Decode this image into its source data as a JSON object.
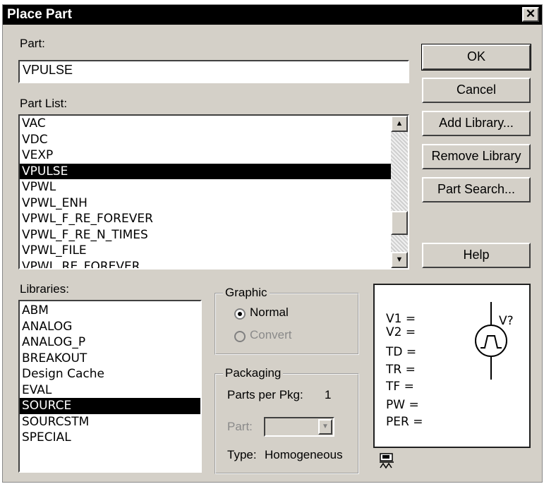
{
  "window": {
    "title": "Place Part",
    "close_glyph": "✕"
  },
  "part": {
    "label": "Part:",
    "value": "VPULSE"
  },
  "part_list": {
    "label": "Part List:",
    "items": [
      "VAC",
      "VDC",
      "VEXP",
      "VPULSE",
      "VPWL",
      "VPWL_ENH",
      "VPWL_F_RE_FOREVER",
      "VPWL_F_RE_N_TIMES",
      "VPWL_FILE",
      "VPWL_RE_FOREVER"
    ],
    "selected": "VPULSE"
  },
  "libraries": {
    "label": "Libraries:",
    "items": [
      "ABM",
      "ANALOG",
      "ANALOG_P",
      "BREAKOUT",
      "Design Cache",
      "EVAL",
      "SOURCE",
      "SOURCSTM",
      "SPECIAL"
    ],
    "selected": "SOURCE"
  },
  "buttons": {
    "ok": "OK",
    "cancel": "Cancel",
    "add_library": "Add Library...",
    "remove_library": "Remove Library",
    "part_search": "Part Search...",
    "help": "Help"
  },
  "graphic": {
    "label": "Graphic",
    "options": [
      {
        "label": "Normal",
        "checked": true,
        "enabled": true
      },
      {
        "label": "Convert",
        "checked": false,
        "enabled": false
      }
    ]
  },
  "packaging": {
    "label": "Packaging",
    "parts_per_pkg_label": "Parts per Pkg:",
    "parts_per_pkg_value": "1",
    "part_label": "Part:",
    "part_value": "",
    "type_label": "Type:",
    "type_value": "Homogeneous"
  },
  "preview": {
    "ref": "V?",
    "pins": [
      "V1 =",
      "V2 =",
      "TD =",
      "TR =",
      "TF =",
      "PW =",
      "PER ="
    ]
  },
  "icons": {
    "scroll_up": "▲",
    "scroll_down": "▼",
    "combo_arrow": "▼"
  },
  "colors": {
    "dialog_bg": "#d4d0c8",
    "titlebar_bg": "#000000",
    "selection_bg": "#000000",
    "disabled_text": "#8a8a8a"
  },
  "scroll": {
    "part_list_position": 0.82
  }
}
